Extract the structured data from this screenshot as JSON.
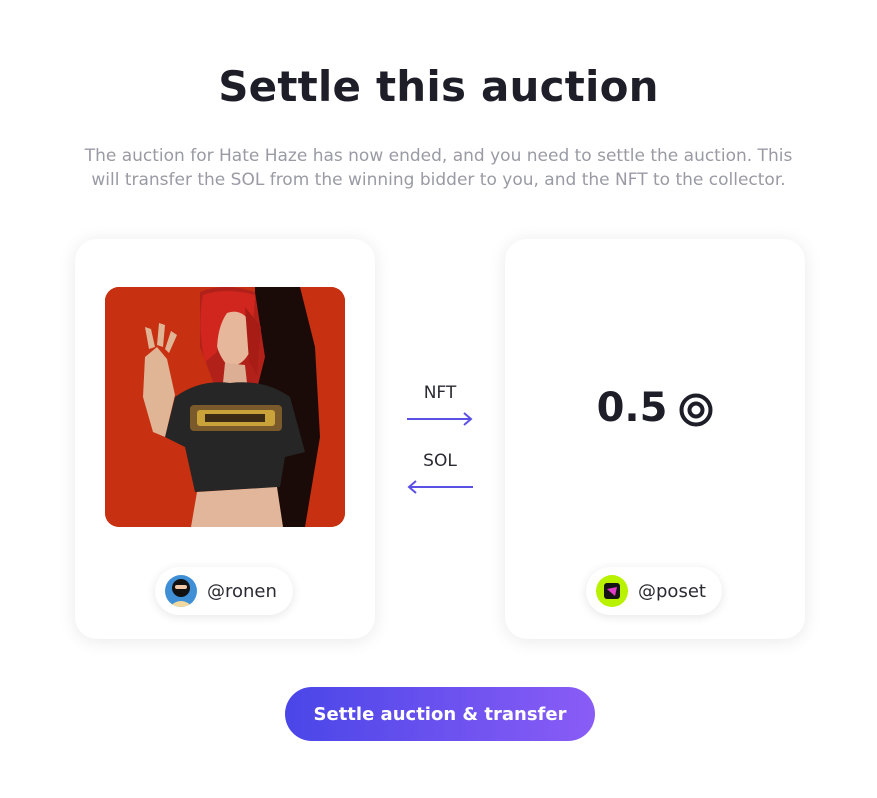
{
  "page": {
    "title": "Settle this auction",
    "description": "The auction for Hate Haze has now ended, and you need to settle the auction. This will transfer the SOL from the winning bidder to you, and the NFT to the collector."
  },
  "seller": {
    "handle": "@ronen",
    "avatar_icon": "masked-avatar"
  },
  "nft": {
    "artwork_icon": "red-haired-figure-artwork",
    "background_color": "#c73010"
  },
  "transfer": {
    "nft_label": "NFT",
    "sol_label": "SOL",
    "arrow_color": "#5b50e6"
  },
  "bid": {
    "amount": "0.5",
    "currency_icon": "sol-icon"
  },
  "collector": {
    "handle": "@poset",
    "avatar_icon": "green-pink-avatar"
  },
  "actions": {
    "settle_label": "Settle auction & transfer"
  },
  "colors": {
    "accent_start": "#4a46e8",
    "accent_end": "#8a5cf6"
  }
}
